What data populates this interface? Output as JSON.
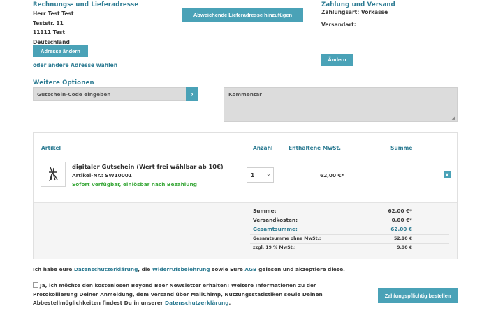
{
  "billing": {
    "title": "Rechnungs- und Lieferadresse",
    "lines": [
      "Herr Test Test",
      "Teststr. 11",
      "11111 Test",
      "Deutschland"
    ],
    "change_button": "Adresse ändern",
    "other_link": "oder andere Adresse wählen"
  },
  "shipping_button": "Abweichende Lieferadresse hinzufügen",
  "payment": {
    "title": "Zahlung und Versand",
    "payment_method": "Zahlungsart: Vorkasse",
    "shipping_method": "Versandart:",
    "change_button": "Ändern"
  },
  "options": {
    "title": "Weitere Optionen",
    "voucher_placeholder": "Gutschein-Code eingeben",
    "comment_placeholder": "Kommentar"
  },
  "cart": {
    "headers": {
      "article": "Artikel",
      "quantity": "Anzahl",
      "tax": "Enthaltene MwSt.",
      "total": "Summe"
    },
    "item": {
      "name": "digitaler Gutschein (Wert frei wählbar ab 10€)",
      "sku": "Artikel-Nr.: SW10001",
      "availability": "Sofort verfügbar, einlösbar nach Bezahlung",
      "quantity": "1",
      "price": "62,00 €*",
      "remove": "x"
    },
    "summary": [
      {
        "label": "Summe:",
        "value": "62,00 €*",
        "highlight": false,
        "small": false
      },
      {
        "label": "Versandkosten:",
        "value": "0,00 €*",
        "highlight": false,
        "small": false
      },
      {
        "label": "Gesamtsumme:",
        "value": "62,00 €",
        "highlight": true,
        "small": false
      },
      {
        "label": "Gesamtsumme ohne MwSt.:",
        "value": "52,10 €",
        "highlight": false,
        "small": true
      },
      {
        "label": "zzgl. 19 % MwSt.:",
        "value": "9,90 €",
        "highlight": false,
        "small": true
      }
    ]
  },
  "legal": {
    "prefix": "Ich habe eure ",
    "privacy": "Datenschutzerklärung",
    "sep1": ", die ",
    "revocation": "Widerrufsbelehrung",
    "sep2": " sowie Eure ",
    "agb": "AGB",
    "suffix": " gelesen und akzeptiere diese."
  },
  "newsletter": {
    "line1": "Ja, ich möchte den kostenlosen Beyond Beer Newsletter erhalten! Weitere Informationen zu der",
    "line2": "Protokollierung Deiner Anmeldung, dem Versand über MailChimp, Nutzungsstatistiken sowie Deinen",
    "line3_prefix": "Abbestellmöglichkeiten findest Du in unserer ",
    "line3_link": "Datenschutzerklärung",
    "line3_suffix": "."
  },
  "order_button": "Zahlungspflichtig bestellen",
  "colors": {
    "accent": "#4aa2b7",
    "heading": "#2e7c93",
    "available": "#3aa83a",
    "field": "#dcdcdc"
  }
}
